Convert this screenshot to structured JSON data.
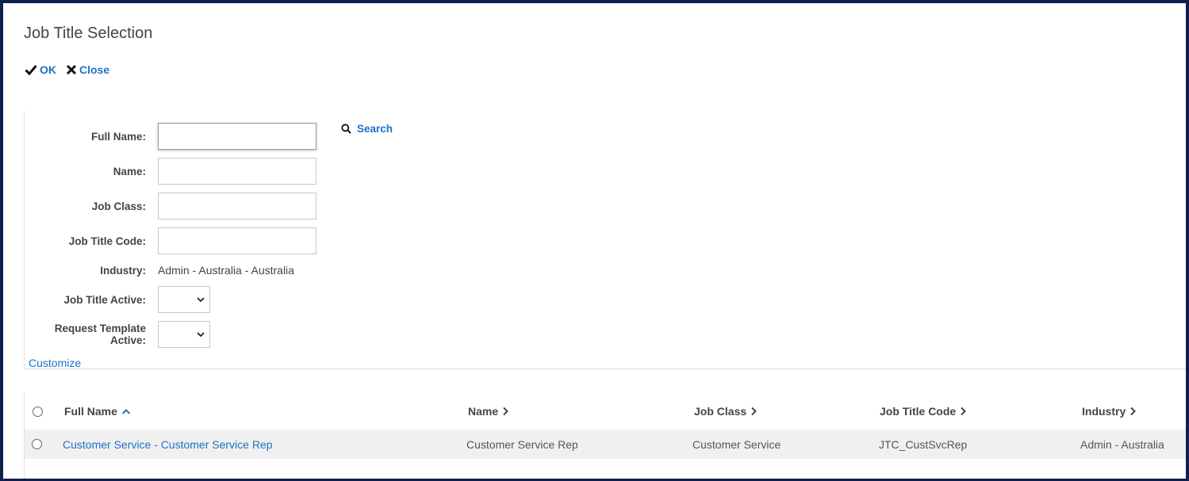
{
  "dialog": {
    "title": "Job Title Selection",
    "actions": {
      "ok_label": "OK",
      "close_label": "Close"
    }
  },
  "filters": {
    "search_label": "Search",
    "customize_label": "Customize",
    "fields": {
      "full_name": {
        "label": "Full Name:",
        "value": ""
      },
      "name": {
        "label": "Name:",
        "value": ""
      },
      "job_class": {
        "label": "Job Class:",
        "value": ""
      },
      "job_title_code": {
        "label": "Job Title Code:",
        "value": ""
      },
      "industry": {
        "label": "Industry:",
        "value": "Admin - Australia - Australia"
      },
      "job_title_active": {
        "label": "Job Title Active:",
        "value": ""
      },
      "request_template_active": {
        "label": "Request Template Active:",
        "value": ""
      }
    }
  },
  "grid": {
    "columns": {
      "full_name": "Full Name",
      "name": "Name",
      "job_class": "Job Class",
      "job_title_code": "Job Title Code",
      "industry": "Industry"
    },
    "sort": {
      "column": "Full Name",
      "direction": "ascending"
    },
    "rows": [
      {
        "full_name": "Customer Service - Customer Service Rep",
        "name": "Customer Service Rep",
        "job_class": "Customer Service",
        "job_title_code": "JTC_CustSvcRep",
        "industry": "Admin - Australia"
      }
    ]
  },
  "colors": {
    "link": "#1a73c8",
    "frame": "#0f1f4f",
    "row_bg": "#f0f0f0"
  }
}
